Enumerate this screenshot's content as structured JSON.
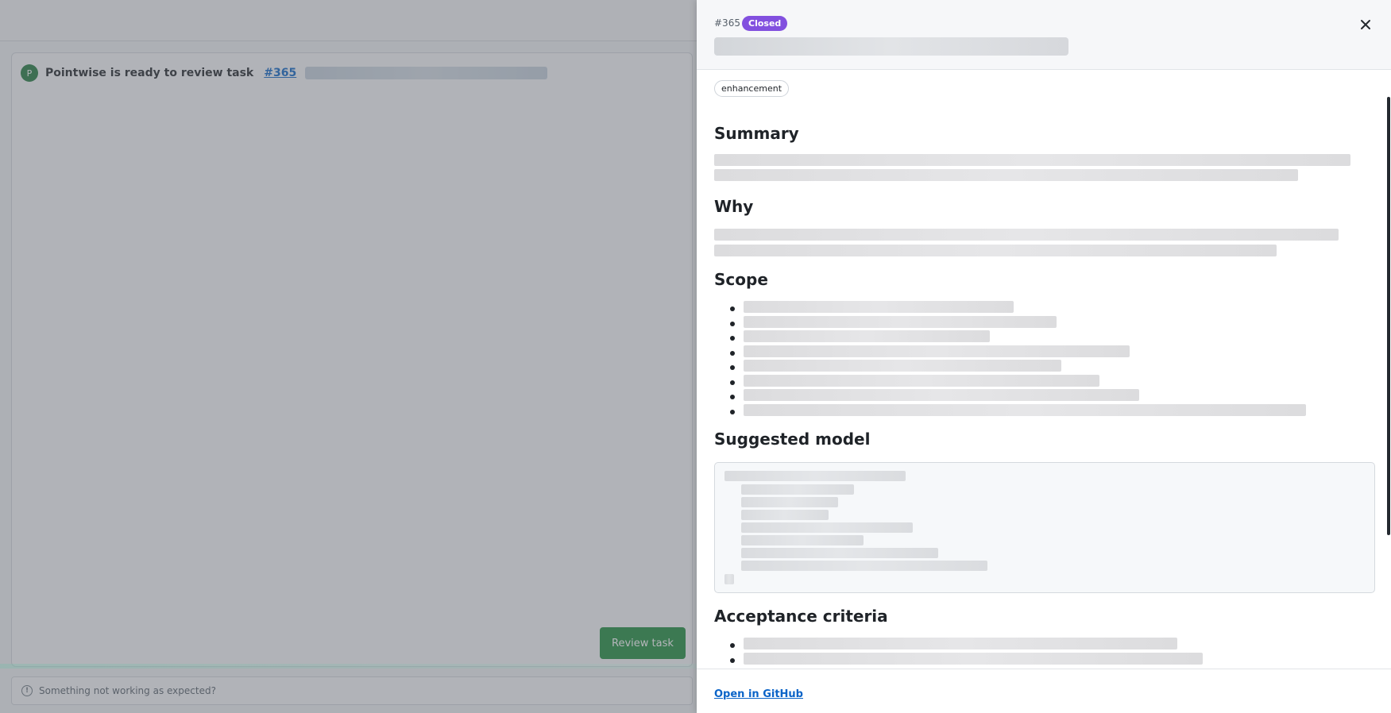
{
  "chat": {
    "avatar_initial": "P",
    "message_prefix": "Pointwise is ready to review task",
    "task_link": "#365",
    "review_button": "Review task",
    "feedback_text": "Something not working as expected?"
  },
  "drawer": {
    "issue_number": "#365",
    "status": "Closed",
    "close_icon": "close-icon",
    "label": "enhancement",
    "sections": {
      "summary": "Summary",
      "why": "Why",
      "scope": "Scope",
      "suggested_model": "Suggested model",
      "acceptance_criteria": "Acceptance criteria"
    },
    "footer_link": "Open in GitHub"
  },
  "colors": {
    "status_closed": "#8250df",
    "primary_button": "#1c8c3b",
    "link": "#0b64c8",
    "avatar": "#1f7a3d"
  }
}
